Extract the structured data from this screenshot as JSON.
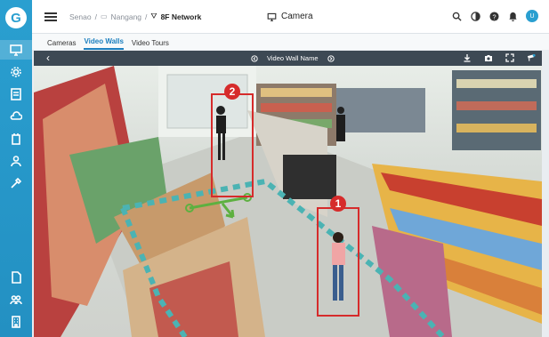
{
  "sidebar": {
    "logo": "G",
    "active_item": "monitor"
  },
  "header": {
    "breadcrumb": [
      "Senao",
      "Nangang",
      "8F Network"
    ],
    "title": "Camera",
    "avatar": "U"
  },
  "tabs": [
    "Cameras",
    "Video Walls",
    "Video Tours"
  ],
  "active_tab": "Video Walls",
  "viewer": {
    "wall_name": "Video Wall Name",
    "back": "‹"
  },
  "detections": [
    {
      "label": "1"
    },
    {
      "label": "2"
    }
  ],
  "colors": {
    "accent": "#2a9fd0",
    "detection": "#d62b2b",
    "zone": "#4bb3b3",
    "line": "#5db040"
  }
}
